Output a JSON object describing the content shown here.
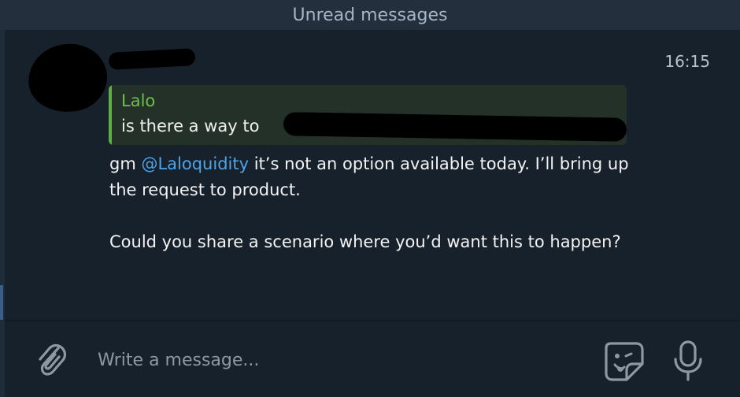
{
  "unread_banner": "Unread messages",
  "message": {
    "time": "16:15",
    "reply": {
      "author": "Lalo",
      "text": "is there a way to"
    },
    "body": {
      "greeting": "gm ",
      "mention": "@Laloquidity",
      "line1_rest": " it’s not an option available today. I’ll bring up the request to product.",
      "paragraph2": "Could you share a scenario where you’d want this to happen?"
    }
  },
  "composer": {
    "placeholder": "Write a message..."
  },
  "icons": {
    "attach": "paperclip-icon",
    "sticker": "sticker-icon",
    "mic": "microphone-icon"
  },
  "colors": {
    "background": "#17212b",
    "mention": "#4fa3e8",
    "reply_accent": "#5fae43",
    "reply_author": "#6cc04a"
  }
}
